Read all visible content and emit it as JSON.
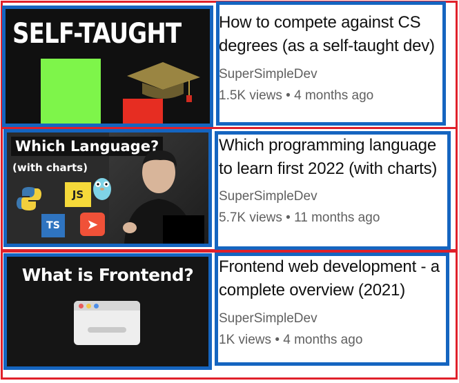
{
  "channel_name": "SuperSimpleDev",
  "videos": [
    {
      "title_line1": "How to compete against CS",
      "title_line2": "degrees (as a self-taught dev)",
      "views": "1.5K views",
      "age": "4 months ago",
      "thumbnail": {
        "text": "SELF-TAUGHT",
        "icons": [
          "graduation-cap-icon"
        ]
      }
    },
    {
      "title_line1": "Which programming language",
      "title_line2": "to learn first 2022 (with charts)",
      "views": "5.7K views",
      "age": "11 months ago",
      "thumbnail": {
        "text": "Which Language?",
        "subtext": "(with charts)",
        "logos": [
          "JS",
          "TS"
        ]
      }
    },
    {
      "title_line1": "Frontend web development - a",
      "title_line2": "complete overview (2021)",
      "views": "1K views",
      "age": "4 months ago",
      "thumbnail": {
        "text": "What is Frontend?",
        "icons": [
          "browser-window-icon"
        ]
      }
    }
  ],
  "separator": "•",
  "colors": {
    "red_annotation": "#e0202a",
    "blue_annotation": "#1565c0",
    "green_bar": "#7ef54a",
    "red_bar": "#e62d22"
  }
}
